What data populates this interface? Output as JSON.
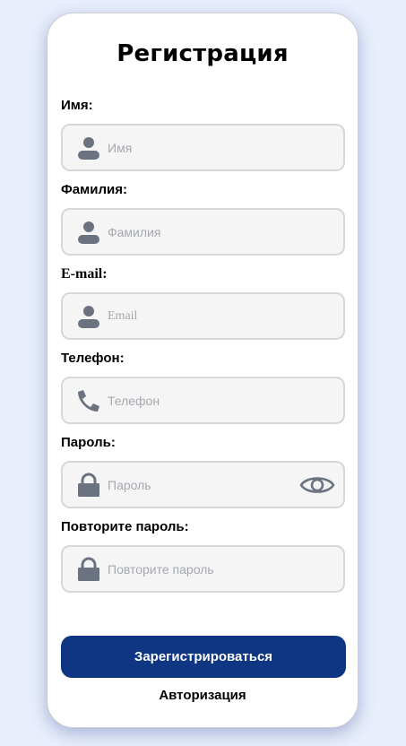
{
  "form": {
    "title": "Регистрация",
    "fields": [
      {
        "label": "Имя:",
        "placeholder": "Имя",
        "icon": "user-icon"
      },
      {
        "label": "Фамилия:",
        "placeholder": "Фамилия",
        "icon": "user-icon"
      },
      {
        "label": "E-mail:",
        "placeholder": "Email",
        "icon": "user-icon"
      },
      {
        "label": "Телефон:",
        "placeholder": "Телефон",
        "icon": "phone-icon"
      },
      {
        "label": "Пароль:",
        "placeholder": "Пароль",
        "icon": "lock-icon",
        "toggle_icon": "eye-icon"
      },
      {
        "label": "Повторите пароль:",
        "placeholder": "Повторите пароль",
        "icon": "lock-icon"
      }
    ],
    "submit_label": "Зарегистрироваться",
    "login_link_label": "Авторизация"
  },
  "colors": {
    "page_background": "#e8eefc",
    "card_background": "#ffffff",
    "primary_button": "#0f3683",
    "icon": "#6b7280",
    "input_background": "#f5f5f5",
    "input_border": "#d7d7d7",
    "placeholder": "#a5a8b0"
  }
}
